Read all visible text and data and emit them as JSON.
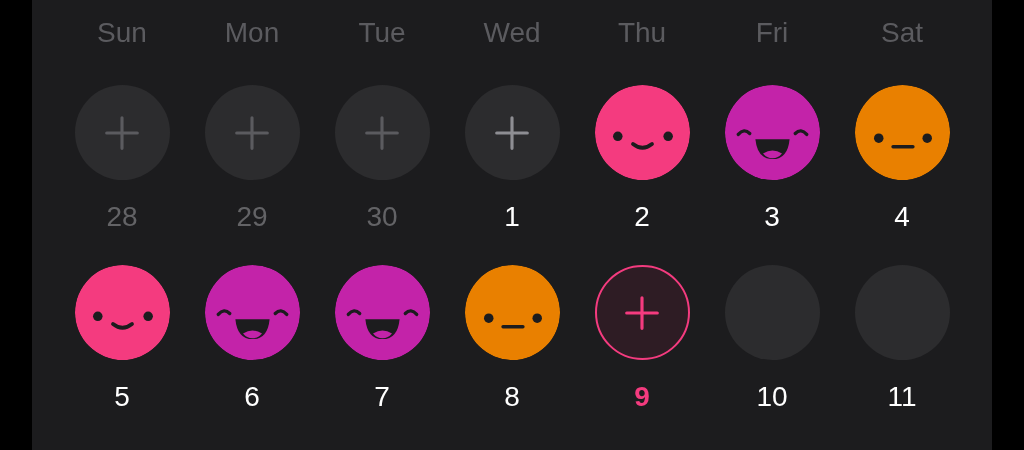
{
  "weekdays": [
    "Sun",
    "Mon",
    "Tue",
    "Wed",
    "Thu",
    "Fri",
    "Sat"
  ],
  "days": [
    {
      "number": "28",
      "kind": "add",
      "outside_month": true
    },
    {
      "number": "29",
      "kind": "add",
      "outside_month": true
    },
    {
      "number": "30",
      "kind": "add",
      "outside_month": true
    },
    {
      "number": "1",
      "kind": "add",
      "outside_month": false
    },
    {
      "number": "2",
      "kind": "smile",
      "color": "#f43b7f",
      "outside_month": false
    },
    {
      "number": "3",
      "kind": "laugh",
      "color": "#c323a9",
      "outside_month": false
    },
    {
      "number": "4",
      "kind": "neutral",
      "color": "#e98000",
      "outside_month": false
    },
    {
      "number": "5",
      "kind": "smile",
      "color": "#f43b7f",
      "outside_month": false
    },
    {
      "number": "6",
      "kind": "laugh",
      "color": "#c323a9",
      "outside_month": false
    },
    {
      "number": "7",
      "kind": "laugh",
      "color": "#c323a9",
      "outside_month": false
    },
    {
      "number": "8",
      "kind": "neutral",
      "color": "#e98000",
      "outside_month": false
    },
    {
      "number": "9",
      "kind": "today",
      "outside_month": false
    },
    {
      "number": "10",
      "kind": "future",
      "outside_month": false
    },
    {
      "number": "11",
      "kind": "future",
      "outside_month": false
    }
  ]
}
